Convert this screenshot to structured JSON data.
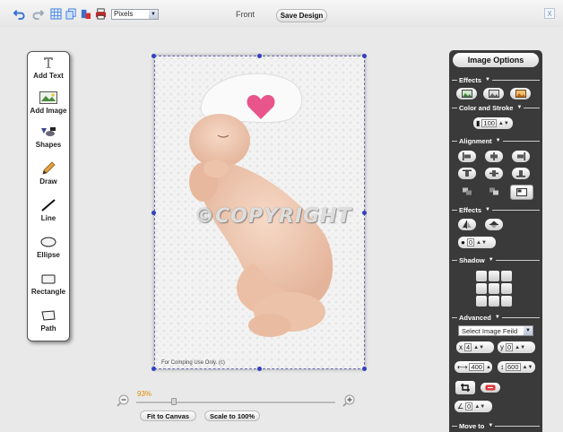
{
  "toolbar": {
    "unit_select": "Pixels",
    "side_label": "Front",
    "save_label": "Save Design",
    "close_label": "X"
  },
  "tools": [
    {
      "label": "Add Text",
      "icon": "text-icon"
    },
    {
      "label": "Add Image",
      "icon": "image-icon"
    },
    {
      "label": "Shapes",
      "icon": "shapes-icon"
    },
    {
      "label": "Draw",
      "icon": "pencil-icon"
    },
    {
      "label": "Line",
      "icon": "line-icon"
    },
    {
      "label": "Ellipse",
      "icon": "ellipse-icon"
    },
    {
      "label": "Rectangle",
      "icon": "rectangle-icon"
    },
    {
      "label": "Path",
      "icon": "path-icon"
    }
  ],
  "canvas": {
    "watermark": "©COPYRIGHT",
    "comp_note": "For Comping Use Only. (c)"
  },
  "zoom": {
    "percent": "93%",
    "level": 0.19,
    "fit_label": "Fit to Canvas",
    "scale_label": "Scale to 100%"
  },
  "options": {
    "title": "Image Options",
    "sections": {
      "effects": "Effects",
      "color_stroke": "Color and Stroke",
      "alignment": "Alignment",
      "effects2": "Effects",
      "shadow": "Shadow",
      "advanced": "Advanced",
      "move_to": "Move to"
    },
    "opacity": "100",
    "blur": "0",
    "image_field": "Select Image Feild",
    "x_label": "x",
    "x_value": "4",
    "y_label": "y",
    "y_value": "0",
    "width": "400",
    "height": "600",
    "rotation": "0"
  },
  "colors": {
    "accent_blue": "#2f6fd6",
    "panel_dark": "#3a3a3a",
    "zoom_orange": "#e08a00",
    "heart_pink": "#e8558a"
  }
}
